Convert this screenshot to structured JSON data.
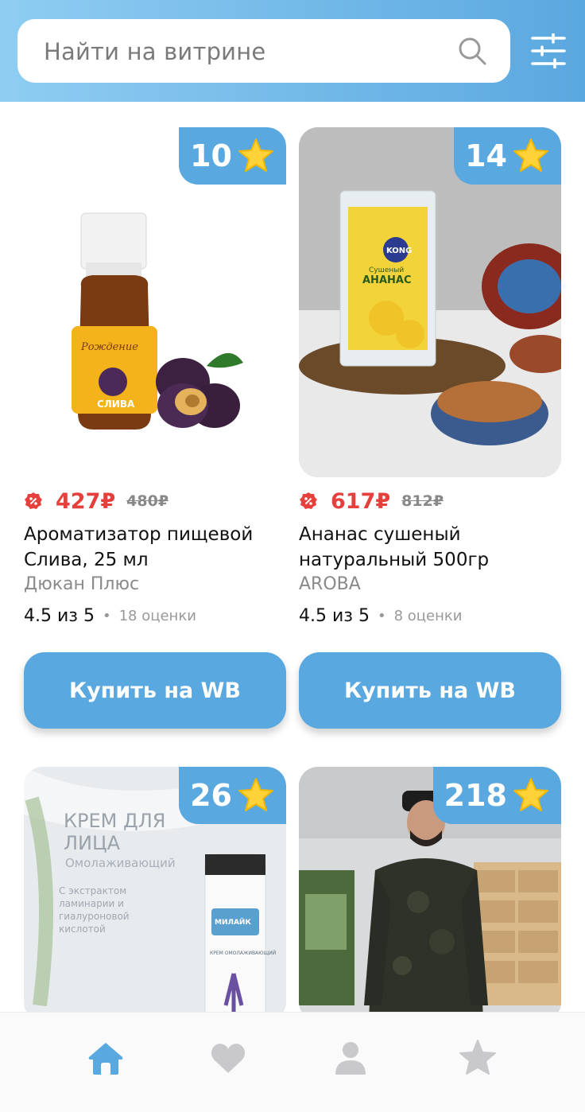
{
  "search": {
    "placeholder": "Найти на витрине",
    "search_icon": "search-icon",
    "filter_icon": "filter-icon"
  },
  "colors": {
    "accent": "#5aa8e0",
    "price": "#e6403c",
    "header_gradient_start": "#8fcdf2",
    "header_gradient_end": "#5aa8e0"
  },
  "products": [
    {
      "badge_count": "10",
      "price": "427₽",
      "old_price": "480₽",
      "title": "Ароматизатор пищевой Слива, 25 мл",
      "brand": "Дюкан Плюс",
      "rating": "4.5 из 5",
      "reviews": "18 оценки",
      "buy_label": "Купить на WB",
      "image_text": {
        "label": "Рождение",
        "flavor": "СЛИВА"
      }
    },
    {
      "badge_count": "14",
      "price": "617₽",
      "old_price": "812₽",
      "title": "Ананас сушеный натуральный 500гр",
      "brand": "AROBA",
      "rating": "4.5 из 5",
      "reviews": "8 оценки",
      "buy_label": "Купить на WB",
      "image_text": {
        "logo": "KONG",
        "line1": "Сушеный",
        "line2": "АНАНАС"
      }
    },
    {
      "badge_count": "26",
      "image_text": {
        "title1": "КРЕМ ДЛЯ",
        "title2": "ЛИЦА",
        "subtitle": "Омолаживающий",
        "d1": "С экстрактом",
        "d2": "ламинарии и",
        "d3": "гиалуроновой",
        "d4": "кислотой",
        "brand": "МИЛАЙК",
        "product": "КРЕМ ОМОЛАЖИВАЮЩИЙ"
      }
    },
    {
      "badge_count": "218"
    }
  ],
  "bottom_nav": [
    {
      "icon": "home-icon",
      "active": true
    },
    {
      "icon": "heart-icon",
      "active": false
    },
    {
      "icon": "profile-icon",
      "active": false
    },
    {
      "icon": "star-icon",
      "active": false
    }
  ]
}
